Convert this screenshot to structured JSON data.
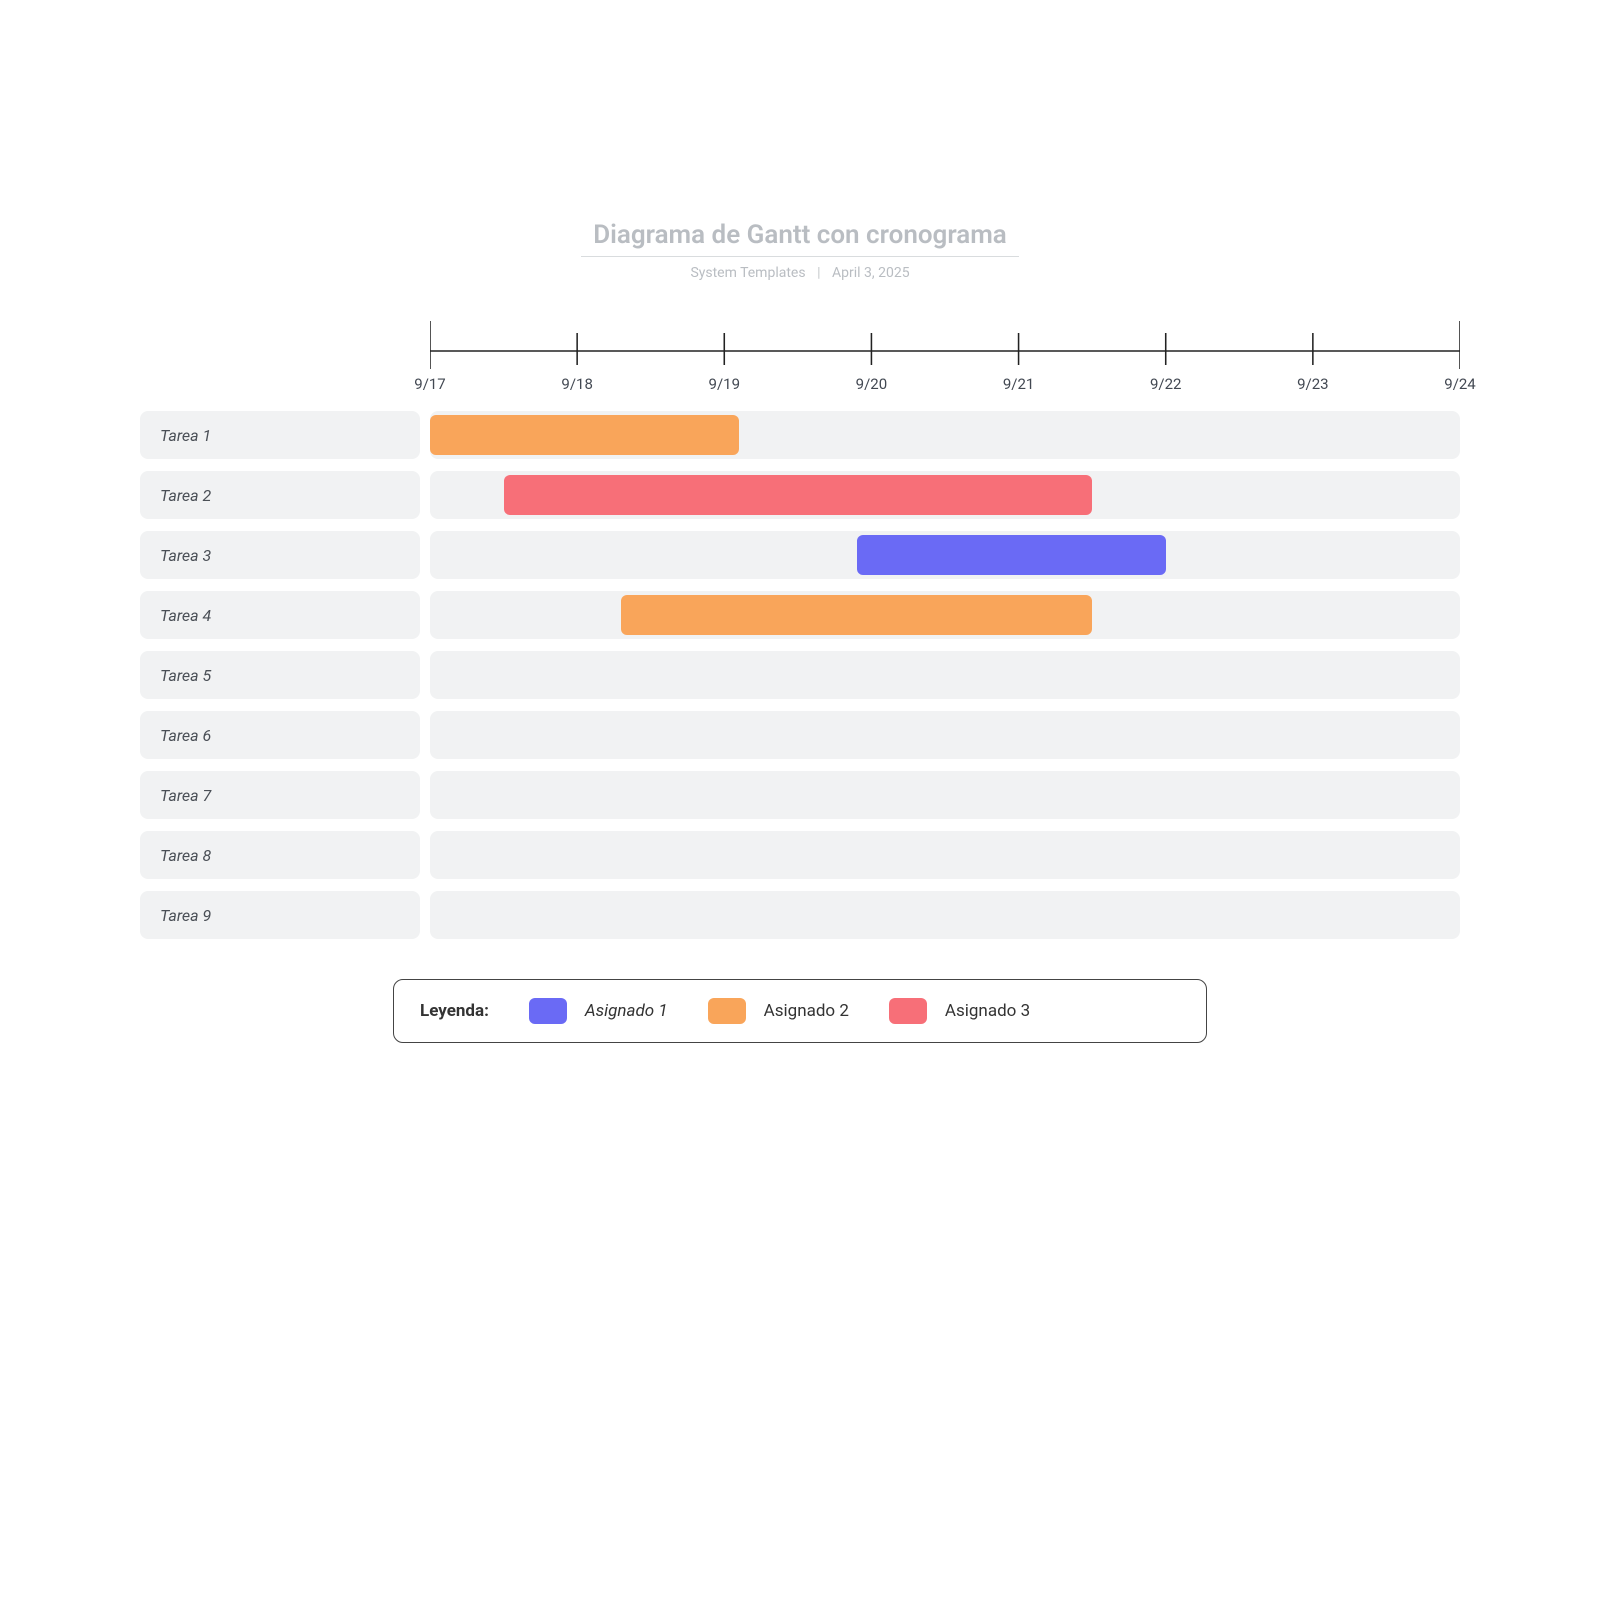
{
  "header": {
    "title": "Diagrama de Gantt con cronograma",
    "source": "System Templates",
    "date": "April 3, 2025"
  },
  "legend": {
    "title": "Leyenda:",
    "items": [
      {
        "label": "Asignado 1",
        "color": "#6a6af5"
      },
      {
        "label": "Asignado 2",
        "color": "#f9a55a"
      },
      {
        "label": "Asignado 3",
        "color": "#f76f78"
      }
    ]
  },
  "chart_data": {
    "type": "bar",
    "title": "Diagrama de Gantt con cronograma",
    "xlabel": "",
    "ylabel": "",
    "x_ticks": [
      "9/17",
      "9/18",
      "9/19",
      "9/20",
      "9/21",
      "9/22",
      "9/23",
      "9/24"
    ],
    "xlim": [
      17,
      24
    ],
    "categories": [
      "Tarea 1",
      "Tarea 2",
      "Tarea 3",
      "Tarea 4",
      "Tarea 5",
      "Tarea 6",
      "Tarea 7",
      "Tarea 8",
      "Tarea 9"
    ],
    "series": [
      {
        "name": "Asignado 1",
        "color": "#6a6af5",
        "bars": [
          {
            "task": "Tarea 3",
            "start": 19.9,
            "end": 22.0
          }
        ]
      },
      {
        "name": "Asignado 2",
        "color": "#f9a55a",
        "bars": [
          {
            "task": "Tarea 1",
            "start": 17.0,
            "end": 19.1
          },
          {
            "task": "Tarea 4",
            "start": 18.3,
            "end": 21.5
          }
        ]
      },
      {
        "name": "Asignado 3",
        "color": "#f76f78",
        "bars": [
          {
            "task": "Tarea 2",
            "start": 17.5,
            "end": 21.5
          }
        ]
      }
    ]
  }
}
